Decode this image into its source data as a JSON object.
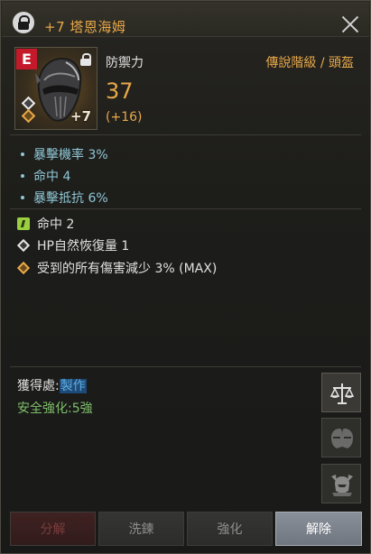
{
  "header": {
    "title": "+7 塔恩海姆"
  },
  "item": {
    "grade_letter": "E",
    "enhance_badge": "+7",
    "stat_label": "防禦力",
    "stat_value": "37",
    "stat_bonus": "(+16)",
    "grade_type": "傳說階級 / 頭盔"
  },
  "options": [
    {
      "label": "暴擊機率 3%"
    },
    {
      "label": "命中 4"
    },
    {
      "label": "暴擊抵抗 6%"
    }
  ],
  "effects": [
    {
      "icon": "green-rune-icon",
      "label": "命中 2"
    },
    {
      "icon": "white-diamond-icon",
      "label": "HP自然恢復量 1"
    },
    {
      "icon": "gold-diamond-icon",
      "label": "受到的所有傷害減少 3% (MAX)"
    }
  ],
  "source": {
    "label": "獲得處:",
    "link": "製作"
  },
  "safe_enhance": "安全強化:5強",
  "side_buttons": [
    "scales-icon",
    "compare-helmet-icon",
    "warrior-helmet-icon"
  ],
  "buttons": {
    "decompose": "分解",
    "wash": "洗鍊",
    "enhance": "強化",
    "release": "解除"
  },
  "colors": {
    "accent_gold": "#e8a84a",
    "option_blue": "#8fc7d6",
    "safe_green": "#7fc06a",
    "grade_red": "#c4192a"
  }
}
